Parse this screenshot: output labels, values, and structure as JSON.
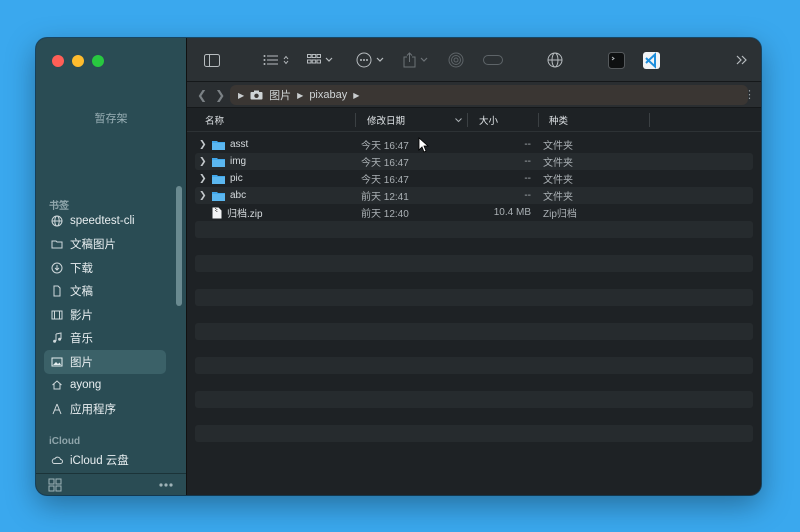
{
  "sidebar": {
    "stash": "暂存架",
    "section_bookmarks": "书签",
    "items": [
      {
        "label": "speedtest-cli",
        "icon": "globe-icon"
      },
      {
        "label": "文稿图片",
        "icon": "folder-icon"
      },
      {
        "label": "下载",
        "icon": "download-icon"
      },
      {
        "label": "文稿",
        "icon": "document-icon"
      },
      {
        "label": "影片",
        "icon": "film-icon"
      },
      {
        "label": "音乐",
        "icon": "music-icon"
      },
      {
        "label": "图片",
        "icon": "photo-icon",
        "active": true
      },
      {
        "label": "ayong",
        "icon": "home-icon"
      },
      {
        "label": "应用程序",
        "icon": "apps-icon"
      }
    ],
    "section_icloud": "iCloud",
    "icloud_items": [
      {
        "label": "iCloud 云盘",
        "icon": "cloud-icon"
      }
    ]
  },
  "pathbar": {
    "crumbs": [
      "图片",
      "pixabay"
    ]
  },
  "columns": {
    "name": "名称",
    "date": "修改日期",
    "size": "大小",
    "kind": "种类"
  },
  "files": [
    {
      "name": "asst",
      "date": "今天 16:47",
      "size": "--",
      "kind": "文件夹",
      "type": "folder"
    },
    {
      "name": "img",
      "date": "今天 16:47",
      "size": "--",
      "kind": "文件夹",
      "type": "folder"
    },
    {
      "name": "pic",
      "date": "今天 16:47",
      "size": "--",
      "kind": "文件夹",
      "type": "folder"
    },
    {
      "name": "abc",
      "date": "前天 12:41",
      "size": "--",
      "kind": "文件夹",
      "type": "folder"
    },
    {
      "name": "归档.zip",
      "date": "前天 12:40",
      "size": "10.4 MB",
      "kind": "Zip归档",
      "type": "zip"
    }
  ],
  "colors": {
    "desktop": "#3aa8ee",
    "sidebar": "#2a4c54",
    "folder": "#41a7ea"
  }
}
